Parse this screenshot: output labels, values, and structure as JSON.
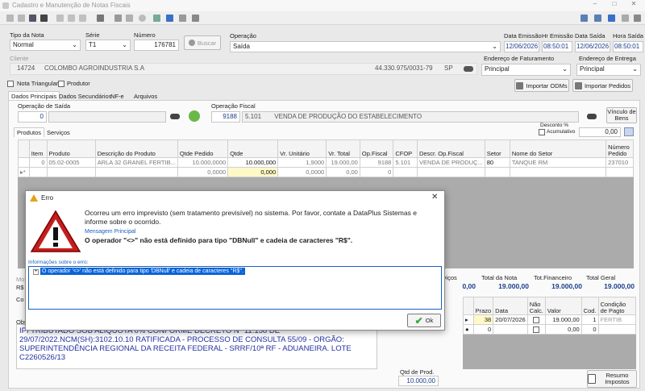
{
  "window": {
    "title": "Cadastro e Manutenção de Notas Fiscais"
  },
  "header": {
    "tipo_nota_label": "Tipo da Nota",
    "tipo_nota_value": "Normal",
    "serie_label": "Série",
    "serie_value": "T1",
    "numero_label": "Número",
    "numero_value": "176781",
    "buscar_label": "Buscar",
    "operacao_label": "Operação",
    "operacao_value": "Saída",
    "data_emissao_label": "Data Emissão",
    "data_emissao_value": "12/06/2026",
    "hr_emissao_label": "Hr Emissão",
    "hr_emissao_value": "08:50:01",
    "data_saida_label": "Data Saída",
    "data_saida_value": "12/06/2026",
    "hora_saida_label": "Hora Saída",
    "hora_saida_value": "08:50:01"
  },
  "cliente": {
    "label": "Cliente",
    "code": "14724",
    "name": "COLOMBO AGROINDUSTRIA S.A",
    "cnpj": "44.330.975/0031-79",
    "uf": "SP"
  },
  "faturamento": {
    "label": "Endereço de Faturamento",
    "value": "Principal"
  },
  "entrega": {
    "label": "Endereço de Entrega",
    "value": "Principal"
  },
  "checks": {
    "nota_triangular": "Nota Triangular",
    "produtor": "Produtor"
  },
  "buttons": {
    "importar_odms": "Importar ODMs",
    "importar_pedidos": "Importar Pedidos",
    "vinculo_bens": "Vínculo de Bens",
    "ok": "Ok",
    "resumo_impostos": "Resumo Impostos"
  },
  "tabs": [
    "Dados Principais",
    "Dados Secundários",
    "NF-e",
    "Arquivos"
  ],
  "operacao_saida": {
    "label": "Operação de Saída",
    "value": "0"
  },
  "operacao_fiscal": {
    "label": "Operação Fiscal",
    "code": "9188",
    "cfop": "5.101",
    "desc": "VENDA DE PRODUÇÃO DO ESTABELECIMENTO"
  },
  "inner_tabs": [
    "Produtos",
    "Serviços"
  ],
  "desconto": {
    "label": "Desconto %",
    "acumulativo": "Acumulativo",
    "value": "0,00"
  },
  "grid": {
    "columns": [
      "Item",
      "Produto",
      "Descrição do Produto",
      "Qtde Pedido",
      "Qtde",
      "Vr. Unitário",
      "Vr. Total",
      "Op.Fiscal",
      "CFOP",
      "Descr. Op.Fiscal",
      "Setor",
      "Nome do Setor",
      "Número Pedido"
    ],
    "rows": [
      [
        "0",
        "05.02-0005",
        "ARLA 32 GRANEL FERTIB...",
        "10.000,0000",
        "10.000,000",
        "1,9000",
        "19.000,00",
        "9188",
        "5.101",
        "VENDA DE PRODUÇ...",
        "80",
        "TANQUE RM",
        "237010"
      ],
      [
        "",
        "",
        "",
        "0,0000",
        "0,000",
        "0,0000",
        "0,00",
        "0",
        "",
        "",
        "",
        "",
        ""
      ]
    ]
  },
  "dialog": {
    "title": "Erro",
    "message": "Ocorreu um erro imprevisto (sem tratamento previsível) no sistema. Por favor, contate a DataPlus Sistemas e informe sobre o ocorrido.",
    "main_label": "Mensagem Principal",
    "main_message": "O operador \"<>\" não está definido para tipo \"DBNull\" e cadeia de caracteres \"R$\".",
    "info_label": "Informações sobre o erro:",
    "info_item": "O operador '<>' não está definido para tipo 'DBNull' e cadeia de caracteres ''R$''."
  },
  "totals": {
    "servicos_label": "Serviços",
    "servicos_value": "0,00",
    "total_nota_label": "Total da Nota",
    "total_nota_value": "19.000,00",
    "total_fin_label": "Tot.Financeiro",
    "total_fin_value": "19.000,00",
    "total_geral_label": "Total Geral",
    "total_geral_value": "19.000,00"
  },
  "parcelas": {
    "columns": [
      "Prazo",
      "Data",
      "Não Calc.",
      "Valor",
      "Cod.",
      "Condição de Pagto"
    ],
    "rows": [
      [
        "38",
        "20/07/2026",
        "",
        "19.000,00",
        "1",
        "FERTIB"
      ],
      [
        "0",
        "",
        "",
        "0,00",
        "0",
        ""
      ]
    ]
  },
  "obs": {
    "text": "IPI TRIBUTADO SOB ALIQUOTA 0% CONFORME DECRETO Nº 11.158 DE 29/07/2022.NCM(SH):3102.10.10 RATIFICADA - PROCESSO DE CONSULTA 55/09 - ORGÃO: SUPERINTENDÊNCIA REGIONAL DA RECEITA FEDERAL - SRRF/10ª RF - ADUANEIRA. LOTE C2260526/13"
  },
  "qtd_prod": {
    "label": "Qtd de Prod.",
    "value": "10.000,00"
  },
  "fragments": {
    "mo": "Mo",
    "rs": "R$",
    "cor": "Co",
    "obs": "Obs"
  },
  "colors": {
    "accent": "#1a3e8a",
    "selection": "#0a64d8",
    "title_text": "#999999"
  }
}
